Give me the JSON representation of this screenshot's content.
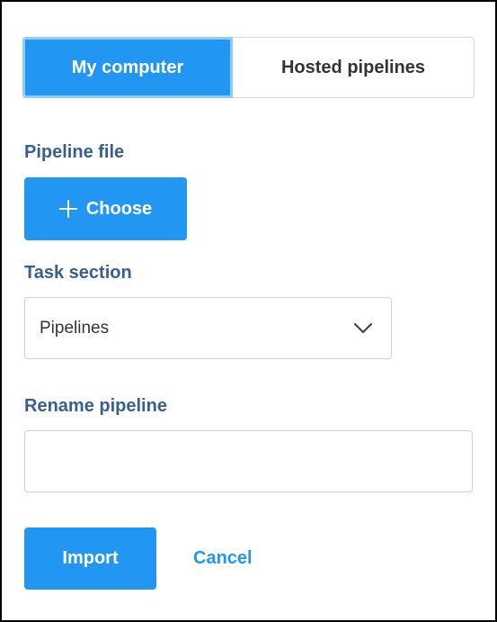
{
  "tabs": {
    "my_computer": "My computer",
    "hosted_pipelines": "Hosted pipelines",
    "active": "My computer"
  },
  "pipeline_file": {
    "label": "Pipeline file",
    "choose_button": "Choose",
    "choose_icon": "plus-icon"
  },
  "task_section": {
    "label": "Task section",
    "selected_value": "Pipelines",
    "dropdown_icon": "chevron-down-icon"
  },
  "rename_pipeline": {
    "label": "Rename pipeline",
    "value": "",
    "placeholder": ""
  },
  "actions": {
    "import_button": "Import",
    "cancel_link": "Cancel"
  },
  "colors": {
    "primary": "#2196f3",
    "label": "#375f8f",
    "frame_border": "#000000"
  }
}
